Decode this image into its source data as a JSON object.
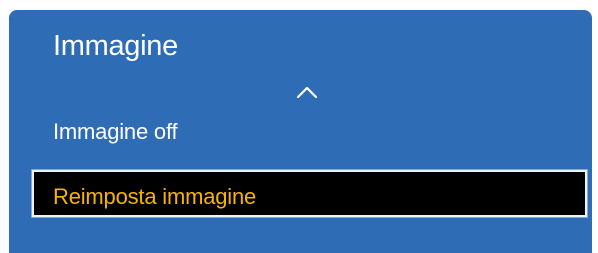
{
  "menu": {
    "title": "Immagine",
    "scroll_up_icon": "chevron-up-icon",
    "items": [
      {
        "label": "Immagine off",
        "selected": false
      },
      {
        "label": "Reimposta immagine",
        "selected": true
      }
    ]
  },
  "colors": {
    "panel_background": "#2e6db5",
    "text": "#ffffff",
    "selected_background": "#000000",
    "selected_text": "#f5b400",
    "selection_border": "#eef3f8"
  }
}
